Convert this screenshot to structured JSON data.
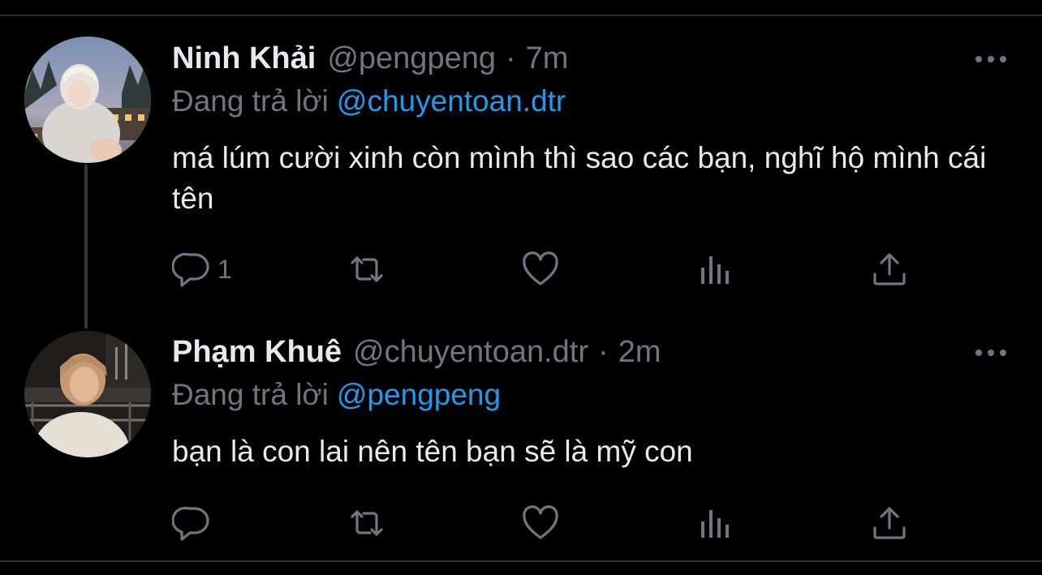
{
  "tweets": [
    {
      "display_name": "Ninh Khải",
      "handle": "@pengpeng",
      "separator": "·",
      "time": "7m",
      "reply_prefix": "Đang trả lời",
      "reply_mention": "@chuyentoan.dtr",
      "text": "má lúm cười xinh còn mình thì sao các bạn, nghĩ hộ mình cái tên",
      "reply_count": "1",
      "retweet_count": "",
      "like_count": "",
      "views_count": ""
    },
    {
      "display_name": "Phạm Khuê",
      "handle": "@chuyentoan.dtr",
      "separator": "·",
      "time": "2m",
      "reply_prefix": "Đang trả lời",
      "reply_mention": "@pengpeng",
      "text": "bạn là con lai nên tên bạn sẽ là mỹ con",
      "reply_count": "",
      "retweet_count": "",
      "like_count": "",
      "views_count": ""
    }
  ],
  "icons": {
    "reply": "reply-icon",
    "retweet": "retweet-icon",
    "like": "heart-icon",
    "views": "views-icon",
    "share": "share-icon",
    "more": "more-icon"
  },
  "colors": {
    "background": "#000000",
    "text_primary": "#e7e9ea",
    "text_secondary": "#71767b",
    "accent": "#1d9bf0",
    "divider": "#2f3336"
  }
}
